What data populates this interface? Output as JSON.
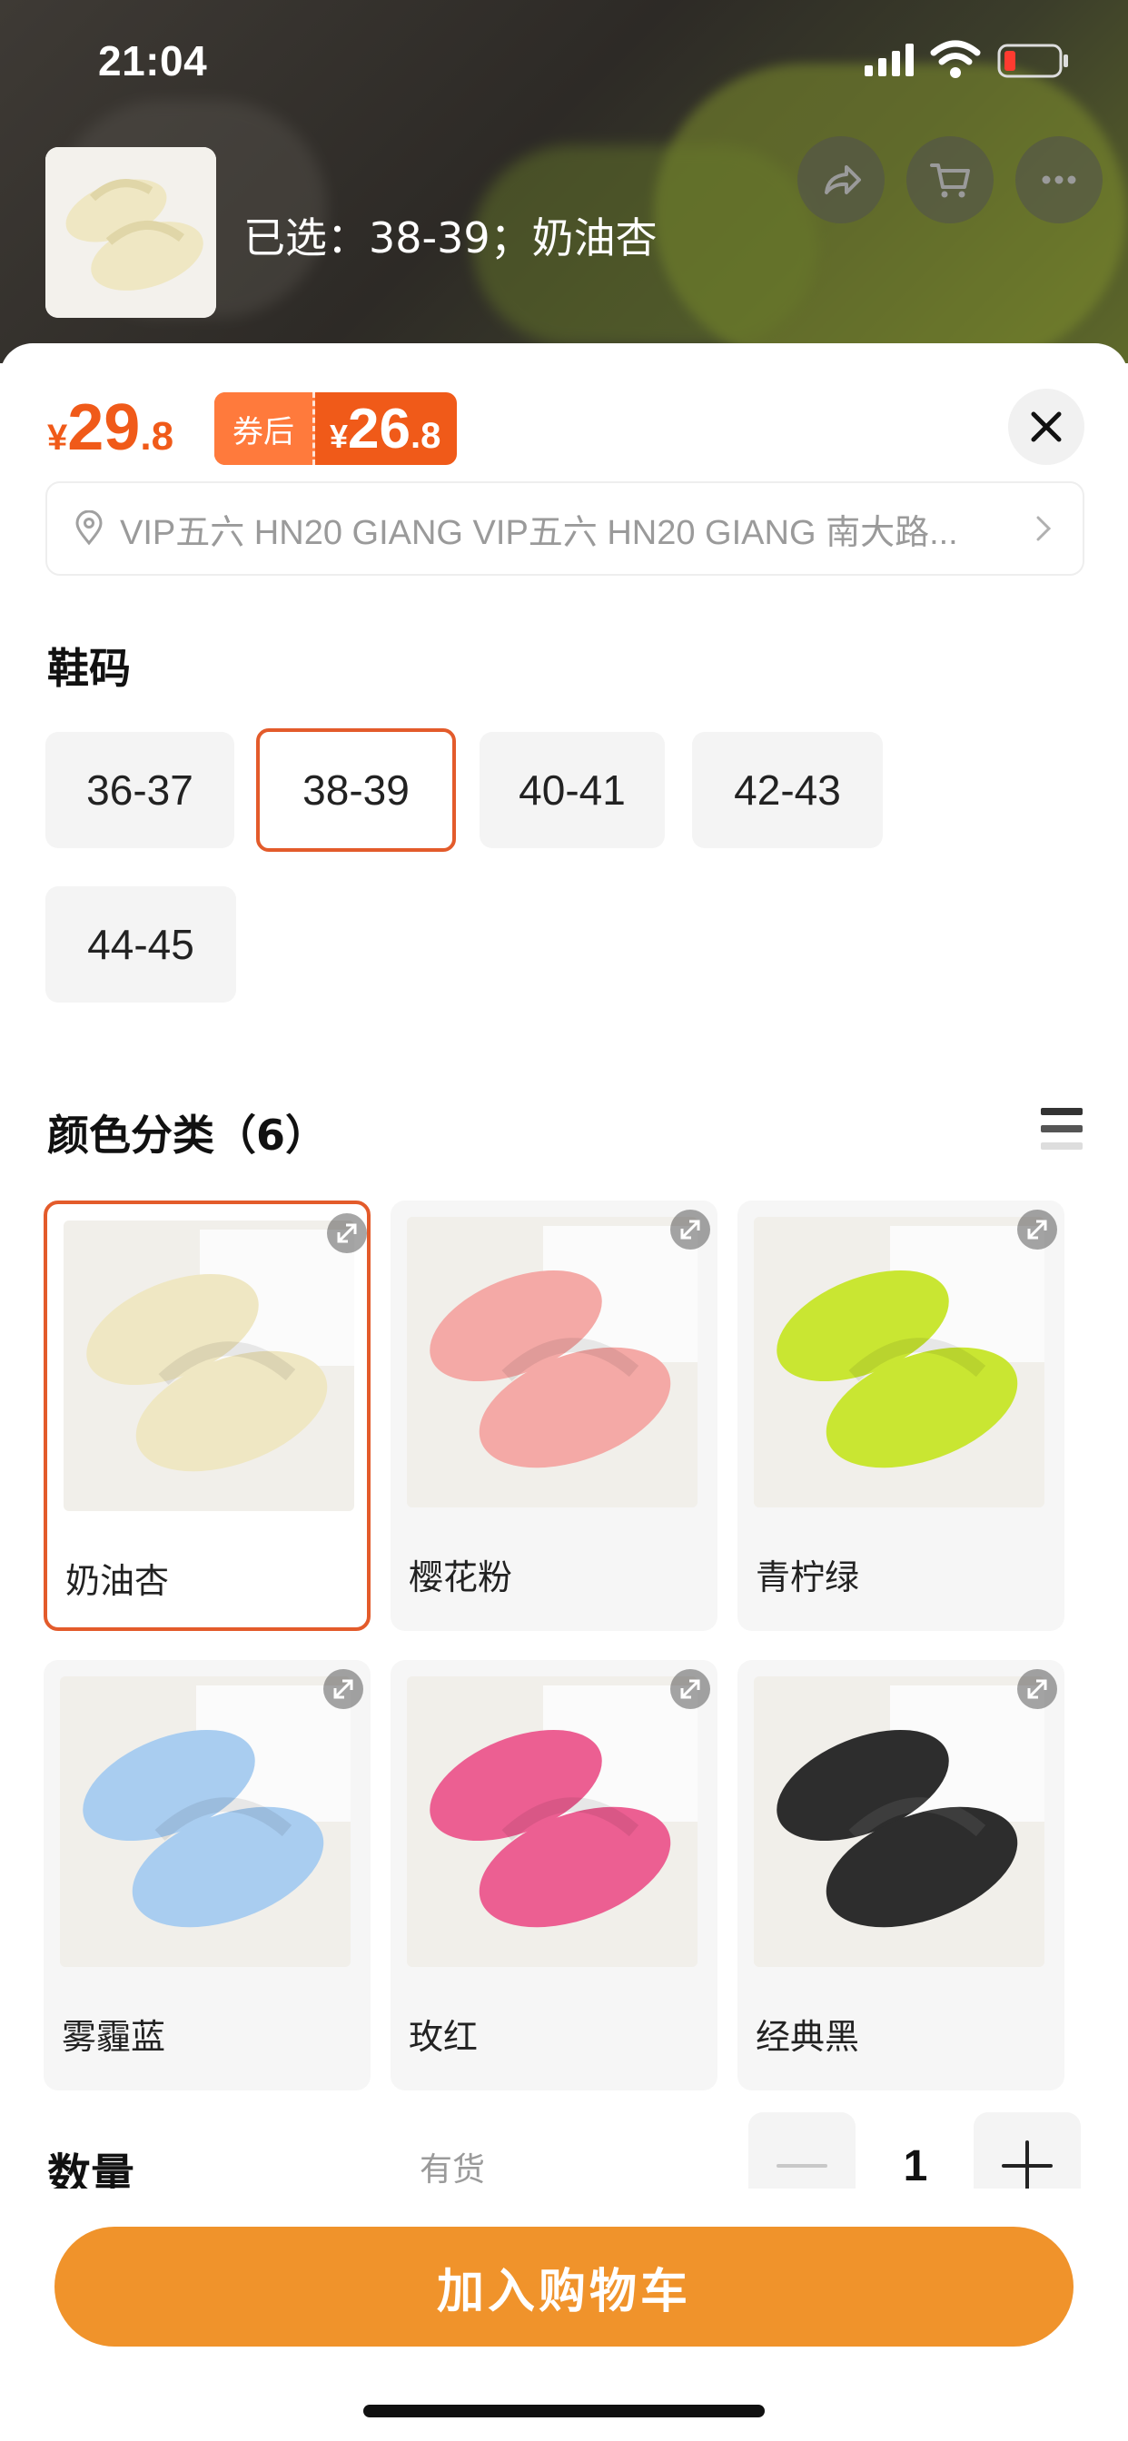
{
  "status_bar": {
    "time": "21:04"
  },
  "header": {
    "selected_text": "已选：38-39；奶油杏"
  },
  "price": {
    "currency": "¥",
    "original_int": "29",
    "original_dec": ".8",
    "coupon_label": "券后",
    "coupon_currency": "¥",
    "coupon_int": "26",
    "coupon_dec": ".8"
  },
  "address": {
    "text": "VIP五六 HN20 GIANG VIP五六 HN20 GIANG 南大路..."
  },
  "size_section": {
    "title": "鞋码",
    "options": [
      "36-37",
      "38-39",
      "40-41",
      "42-43",
      "44-45"
    ],
    "selected": "38-39"
  },
  "color_section": {
    "title": "颜色分类（6）",
    "options": [
      "奶油杏",
      "樱花粉",
      "青柠绿",
      "雾霾蓝",
      "玫红",
      "经典黑"
    ],
    "selected": "奶油杏",
    "swatches": [
      "#efe7c3",
      "#f4a9a6",
      "#c9e632",
      "#a9cdf0",
      "#ec5f92",
      "#2d2d2d"
    ]
  },
  "quantity": {
    "label": "数量",
    "stock": "有货",
    "value": "1"
  },
  "cta": {
    "add_to_cart": "加入购物车"
  },
  "colors": {
    "accent": "#f05a19",
    "cta": "#f0932b",
    "selected_border": "#e35b2b"
  }
}
